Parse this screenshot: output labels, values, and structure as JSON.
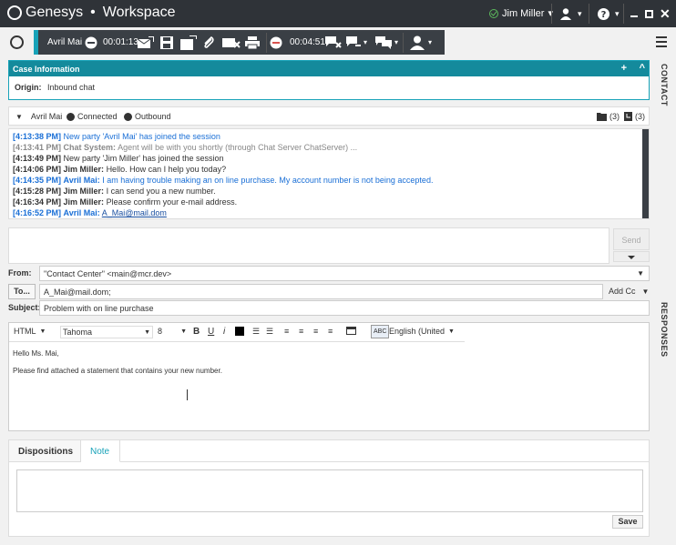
{
  "app": {
    "brand": "Genesys",
    "separator": "•",
    "title": "Workspace"
  },
  "topbar": {
    "user_name": "Jim Miller",
    "dropdown": "▾"
  },
  "interaction": {
    "contact_name": "Avril Mai",
    "chat_timer": "00:01:13",
    "call_timer": "00:04:51"
  },
  "case": {
    "header": "Case Information",
    "add": "+",
    "collapse": "^",
    "origin_label": "Origin:",
    "origin_value": "Inbound chat"
  },
  "side_tabs": {
    "contact": "CONTACT",
    "responses": "RESPONSES"
  },
  "party": {
    "name": "Avril Mai",
    "connected": "Connected",
    "outbound": "Outbound",
    "count_a": "(3)",
    "count_b": "(3)"
  },
  "transcript": [
    {
      "time": "[4:13:38 PM]",
      "speaker": "",
      "text": "New party 'Avril Mai' has joined the session",
      "kind": "client-system"
    },
    {
      "time": "[4:13:41 PM]",
      "speaker": "Chat System:",
      "text": "Agent will be with you shortly (through Chat Server ChatServer) ...",
      "kind": "system"
    },
    {
      "time": "[4:13:49 PM]",
      "speaker": "",
      "text": "New party 'Jim Miller' has joined the session",
      "kind": "agent-system"
    },
    {
      "time": "[4:14:06 PM]",
      "speaker": "Jim Miller:",
      "text": "Hello. How can I help you today?",
      "kind": "agent"
    },
    {
      "time": "[4:14:35 PM]",
      "speaker": "Avril Mai:",
      "text": "I am having trouble making an on line purchase. My account number is not being accepted.",
      "kind": "client"
    },
    {
      "time": "[4:15:28 PM]",
      "speaker": "Jim Miller:",
      "text": "I can send you a new number.",
      "kind": "agent"
    },
    {
      "time": "[4:16:34 PM]",
      "speaker": "Jim Miller:",
      "text": "Please confirm your e-mail address.",
      "kind": "agent"
    },
    {
      "time": "[4:16:52 PM]",
      "speaker": "Avril Mai:",
      "text": "A_Mai@mail.dom",
      "kind": "client-link"
    }
  ],
  "compose": {
    "send_label": "Send"
  },
  "email": {
    "from_label": "From:",
    "from_value": "\"Contact Center\" <main@mcr.dev>",
    "to_button": "To...",
    "to_value": "A_Mai@mail.dom;",
    "add_cc": "Add Cc",
    "subject_label": "Subject:",
    "subject_value": "Problem with on line purchase"
  },
  "editor": {
    "format": "HTML",
    "font": "Tahoma",
    "size": "8",
    "bold": "B",
    "underline": "U",
    "italic": "i",
    "language": "English (United",
    "spell": "ABC",
    "body_line1": "Hello Ms. Mai,",
    "body_line2": "Please find attached a statement that contains your new number."
  },
  "bottom": {
    "tab_dispositions": "Dispositions",
    "tab_note": "Note",
    "save_label": "Save"
  },
  "colors": {
    "accent": "#17a2b8",
    "client": "#1a6fd6",
    "agent": "#333333",
    "system": "#888888",
    "topbar": "#2f3338"
  }
}
